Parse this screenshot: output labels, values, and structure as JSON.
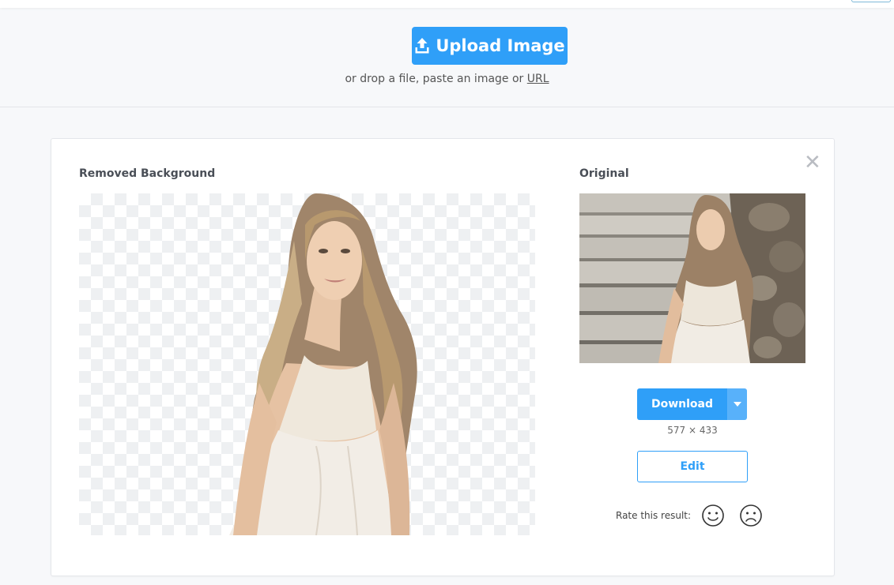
{
  "upload": {
    "button_label": "Upload Image",
    "hint_prefix": "or drop a file, paste an image or ",
    "hint_link": "URL"
  },
  "result": {
    "removed_title": "Removed Background",
    "original_title": "Original",
    "close_glyph": "✕",
    "download_label": "Download",
    "dimensions": "577 × 433",
    "edit_label": "Edit",
    "rate_label": "Rate this result:"
  },
  "icons": {
    "upload": "upload-icon",
    "close": "close-icon",
    "caret": "chevron-down-icon",
    "happy": "smiley-face-icon",
    "sad": "sad-face-icon"
  },
  "colors": {
    "accent": "#2f9ff8",
    "accent_light": "#58b1fa",
    "page_bg": "#f7f8fa",
    "checker": "#eef0f2"
  }
}
